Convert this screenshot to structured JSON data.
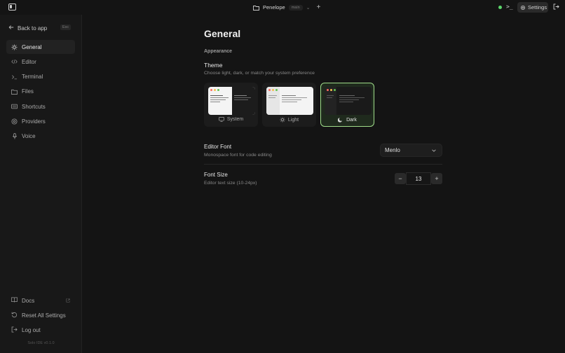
{
  "topbar": {
    "project_name": "Penelope",
    "branch": "main",
    "settings_label": "Settings",
    "status_color": "#5bd66b"
  },
  "sidebar": {
    "back_label": "Back to app",
    "esc_label": "Esc",
    "items": [
      {
        "label": "General",
        "icon": "sun-icon",
        "active": true
      },
      {
        "label": "Editor",
        "icon": "code-icon",
        "active": false
      },
      {
        "label": "Terminal",
        "icon": "terminal-icon",
        "active": false
      },
      {
        "label": "Files",
        "icon": "folder-icon",
        "active": false
      },
      {
        "label": "Shortcuts",
        "icon": "keyboard-icon",
        "active": false
      },
      {
        "label": "Providers",
        "icon": "providers-icon",
        "active": false
      },
      {
        "label": "Voice",
        "icon": "microphone-icon",
        "active": false
      }
    ],
    "bottom": {
      "docs_label": "Docs",
      "reset_label": "Reset All Settings",
      "logout_label": "Log out"
    },
    "version": "Solo IDE v0.1.0"
  },
  "main": {
    "title": "General",
    "section": "Appearance",
    "theme": {
      "title": "Theme",
      "description": "Choose light, dark, or match your system preference",
      "options": [
        {
          "label": "System",
          "icon": "monitor-icon",
          "selected": false
        },
        {
          "label": "Light",
          "icon": "sun-icon",
          "selected": false
        },
        {
          "label": "Dark",
          "icon": "moon-icon",
          "selected": true
        }
      ],
      "accent": "#9fdc8a"
    },
    "editor_font": {
      "title": "Editor Font",
      "description": "Monospace font for code editing",
      "value": "Menlo"
    },
    "font_size": {
      "title": "Font Size",
      "description": "Editor text size (10-24px)",
      "value": "13",
      "decrement": "−",
      "increment": "+"
    }
  }
}
